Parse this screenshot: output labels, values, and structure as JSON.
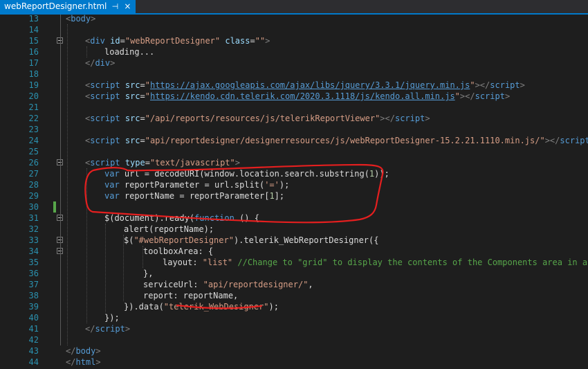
{
  "tab": {
    "title": "webReportDesigner.html",
    "pin_icon": "⊣",
    "close_icon": "×"
  },
  "lines": [
    {
      "n": "13",
      "segs": [
        [
          "t-tag",
          "<"
        ],
        [
          "t-name",
          "body"
        ],
        [
          "t-tag",
          ">"
        ]
      ],
      "indent": 0
    },
    {
      "n": "14",
      "segs": [],
      "indent": 0
    },
    {
      "n": "15",
      "segs": [
        [
          "t-tag",
          "<"
        ],
        [
          "t-name",
          "div"
        ],
        [
          "t-attr",
          " id"
        ],
        [
          "t-id",
          "="
        ],
        [
          "t-str",
          "\"webReportDesigner\""
        ],
        [
          "t-attr",
          " class"
        ],
        [
          "t-id",
          "="
        ],
        [
          "t-str",
          "\"\""
        ],
        [
          "t-tag",
          ">"
        ]
      ],
      "indent": 1
    },
    {
      "n": "16",
      "segs": [
        [
          "t-id",
          "loading..."
        ]
      ],
      "indent": 2
    },
    {
      "n": "17",
      "segs": [
        [
          "t-tag",
          "</"
        ],
        [
          "t-name",
          "div"
        ],
        [
          "t-tag",
          ">"
        ]
      ],
      "indent": 1
    },
    {
      "n": "18",
      "segs": [],
      "indent": 0
    },
    {
      "n": "19",
      "segs": [
        [
          "t-tag",
          "<"
        ],
        [
          "t-name",
          "script"
        ],
        [
          "t-attr",
          " src"
        ],
        [
          "t-id",
          "="
        ],
        [
          "t-str",
          "\""
        ],
        [
          "t-url",
          "https://ajax.googleapis.com/ajax/libs/jquery/3.3.1/jquery.min.js"
        ],
        [
          "t-str",
          "\""
        ],
        [
          "t-tag",
          "></"
        ],
        [
          "t-name",
          "script"
        ],
        [
          "t-tag",
          ">"
        ]
      ],
      "indent": 1
    },
    {
      "n": "20",
      "segs": [
        [
          "t-tag",
          "<"
        ],
        [
          "t-name",
          "script"
        ],
        [
          "t-attr",
          " src"
        ],
        [
          "t-id",
          "="
        ],
        [
          "t-str",
          "\""
        ],
        [
          "t-url",
          "https://kendo.cdn.telerik.com/2020.3.1118/js/kendo.all.min.js"
        ],
        [
          "t-str",
          "\""
        ],
        [
          "t-tag",
          "></"
        ],
        [
          "t-name",
          "script"
        ],
        [
          "t-tag",
          ">"
        ]
      ],
      "indent": 1
    },
    {
      "n": "21",
      "segs": [],
      "indent": 0
    },
    {
      "n": "22",
      "segs": [
        [
          "t-tag",
          "<"
        ],
        [
          "t-name",
          "script"
        ],
        [
          "t-attr",
          " src"
        ],
        [
          "t-id",
          "="
        ],
        [
          "t-str",
          "\"/api/reports/resources/js/telerikReportViewer\""
        ],
        [
          "t-tag",
          "></"
        ],
        [
          "t-name",
          "script"
        ],
        [
          "t-tag",
          ">"
        ]
      ],
      "indent": 1
    },
    {
      "n": "23",
      "segs": [],
      "indent": 0
    },
    {
      "n": "24",
      "segs": [
        [
          "t-tag",
          "<"
        ],
        [
          "t-name",
          "script"
        ],
        [
          "t-attr",
          " src"
        ],
        [
          "t-id",
          "="
        ],
        [
          "t-str",
          "\"api/reportdesigner/designerresources/js/webReportDesigner-15.2.21.1110.min.js/\""
        ],
        [
          "t-tag",
          "></"
        ],
        [
          "t-name",
          "script"
        ],
        [
          "t-tag",
          ">"
        ]
      ],
      "indent": 1
    },
    {
      "n": "25",
      "segs": [],
      "indent": 0
    },
    {
      "n": "26",
      "segs": [
        [
          "t-tag",
          "<"
        ],
        [
          "t-name",
          "script"
        ],
        [
          "t-attr",
          " type"
        ],
        [
          "t-id",
          "="
        ],
        [
          "t-str",
          "\"text/javascript\""
        ],
        [
          "t-tag",
          ">"
        ]
      ],
      "indent": 1
    },
    {
      "n": "27",
      "segs": [
        [
          "t-kw",
          "var"
        ],
        [
          "t-id",
          " url = decodeURI(window.location.search.substring("
        ],
        [
          "t-num",
          "1"
        ],
        [
          "t-id",
          "));"
        ]
      ],
      "indent": 2
    },
    {
      "n": "28",
      "segs": [
        [
          "t-kw",
          "var"
        ],
        [
          "t-id",
          " reportParameter = url.split("
        ],
        [
          "t-jstr",
          "'='"
        ],
        [
          "t-id",
          ");"
        ]
      ],
      "indent": 2
    },
    {
      "n": "29",
      "segs": [
        [
          "t-kw",
          "var"
        ],
        [
          "t-id",
          " reportName = reportParameter["
        ],
        [
          "t-num",
          "1"
        ],
        [
          "t-id",
          "];"
        ]
      ],
      "indent": 2
    },
    {
      "n": "30",
      "segs": [],
      "indent": 0
    },
    {
      "n": "31",
      "segs": [
        [
          "t-id",
          "$(document).ready("
        ],
        [
          "t-kw",
          "function"
        ],
        [
          "t-id",
          " () {"
        ]
      ],
      "indent": 2
    },
    {
      "n": "32",
      "segs": [
        [
          "t-id",
          "alert(reportName);"
        ]
      ],
      "indent": 3
    },
    {
      "n": "33",
      "segs": [
        [
          "t-id",
          "$("
        ],
        [
          "t-jstr",
          "\"#webReportDesigner\""
        ],
        [
          "t-id",
          ").telerik_WebReportDesigner({"
        ]
      ],
      "indent": 3
    },
    {
      "n": "34",
      "segs": [
        [
          "t-id",
          "toolboxArea: {"
        ]
      ],
      "indent": 4
    },
    {
      "n": "35",
      "segs": [
        [
          "t-id",
          "layout: "
        ],
        [
          "t-jstr",
          "\"list\""
        ],
        [
          "t-com",
          " //Change to \"grid\" to display the contents of the Components area in a flow"
        ]
      ],
      "indent": 5
    },
    {
      "n": "36",
      "segs": [
        [
          "t-id",
          "},"
        ]
      ],
      "indent": 4
    },
    {
      "n": "37",
      "segs": [
        [
          "t-id",
          "serviceUrl: "
        ],
        [
          "t-jstr",
          "\"api/reportdesigner/\""
        ],
        [
          "t-id",
          ","
        ]
      ],
      "indent": 4
    },
    {
      "n": "38",
      "segs": [
        [
          "t-id",
          "report: reportName,"
        ]
      ],
      "indent": 4
    },
    {
      "n": "39",
      "segs": [
        [
          "t-id",
          "}).data("
        ],
        [
          "t-jstr",
          "\"telerik_WebDesigner\""
        ],
        [
          "t-id",
          ");"
        ]
      ],
      "indent": 3
    },
    {
      "n": "40",
      "segs": [
        [
          "t-id",
          "});"
        ]
      ],
      "indent": 2
    },
    {
      "n": "41",
      "segs": [
        [
          "t-tag",
          "</"
        ],
        [
          "t-name",
          "script"
        ],
        [
          "t-tag",
          ">"
        ]
      ],
      "indent": 1
    },
    {
      "n": "42",
      "segs": [],
      "indent": 0
    },
    {
      "n": "43",
      "segs": [
        [
          "t-tag",
          "</"
        ],
        [
          "t-name",
          "body"
        ],
        [
          "t-tag",
          ">"
        ]
      ],
      "indent": 0
    },
    {
      "n": "44",
      "segs": [
        [
          "t-tag",
          "</"
        ],
        [
          "t-name",
          "html"
        ],
        [
          "t-tag",
          ">"
        ]
      ],
      "indent": 0
    }
  ],
  "fold_lines": [
    "15",
    "26",
    "31",
    "33",
    "34"
  ],
  "changed_lines": [
    "30"
  ],
  "colors": {
    "background": "#1e1e1e",
    "annotation": "#e51f1f",
    "tab_accent": "#007acc"
  }
}
